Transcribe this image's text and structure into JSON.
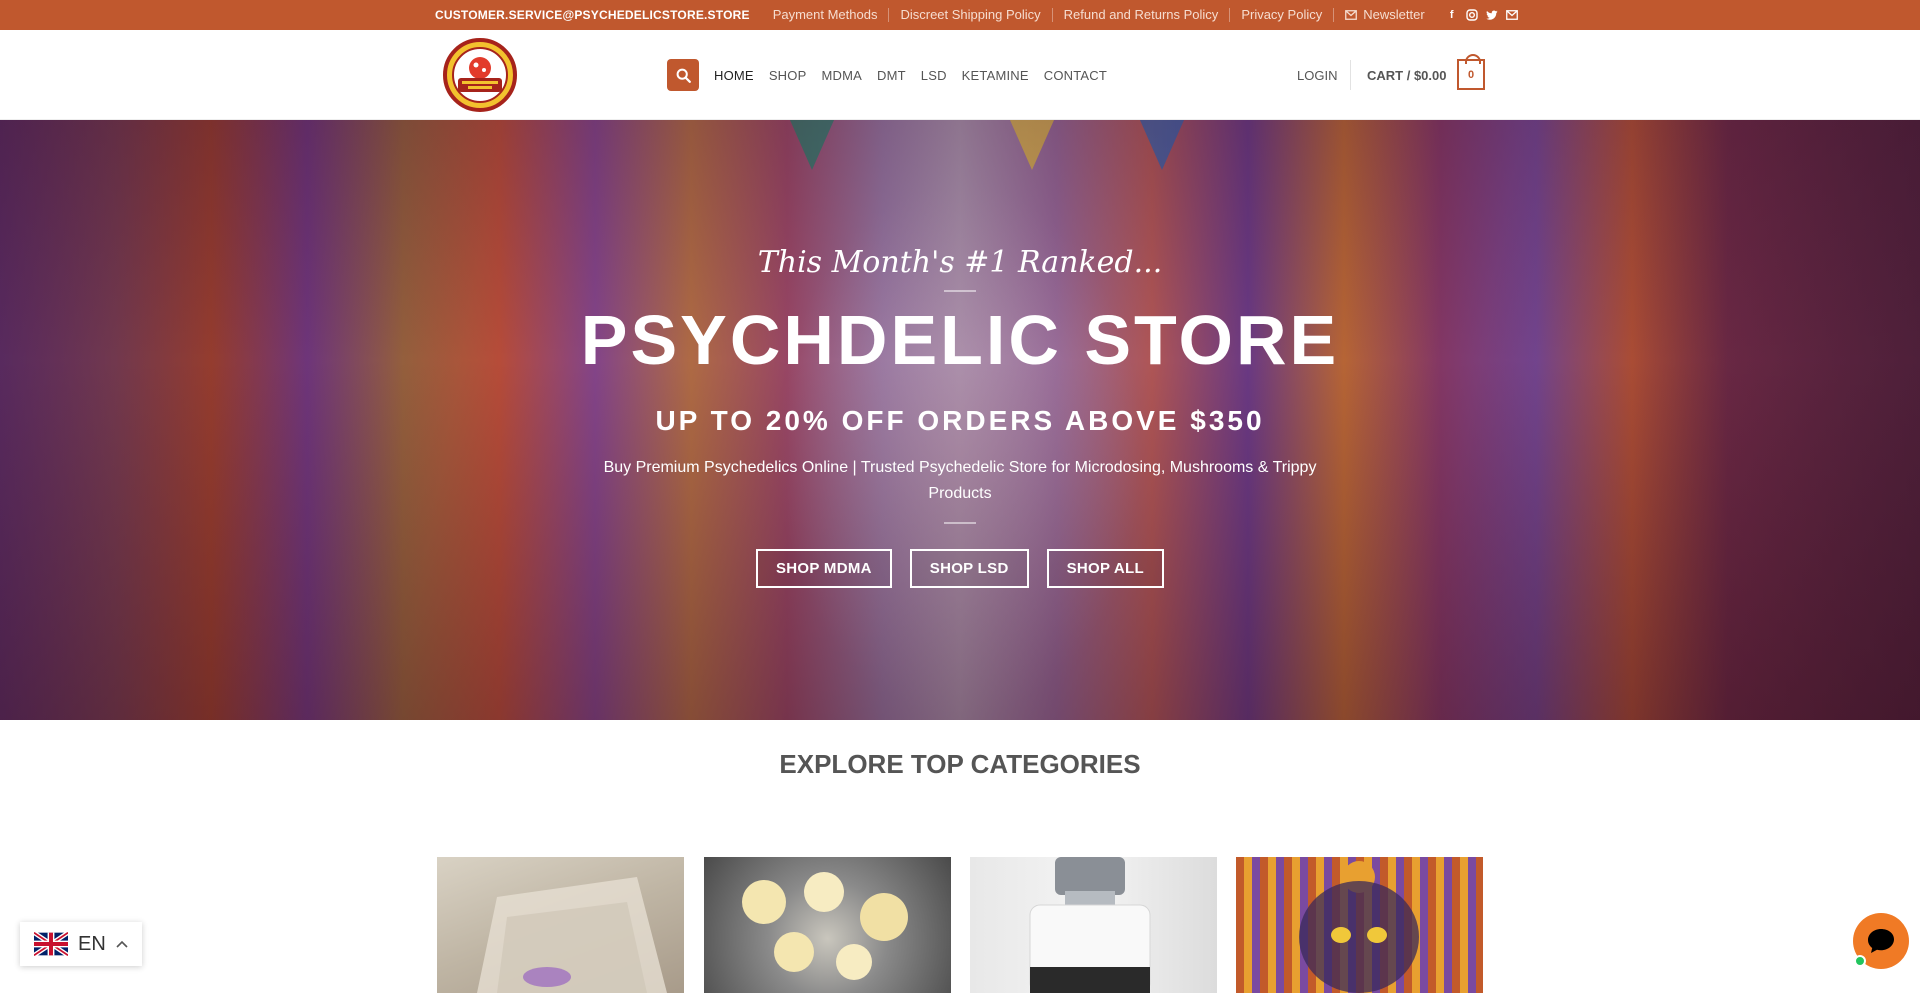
{
  "topbar": {
    "email": "CUSTOMER.SERVICE@PSYCHEDELICSTORE.STORE",
    "links": [
      "Payment Methods",
      "Discreet Shipping Policy",
      "Refund and Returns Policy",
      "Privacy Policy"
    ],
    "newsletter": "Newsletter",
    "social_icons": [
      "facebook-icon",
      "instagram-icon",
      "twitter-icon",
      "email-icon"
    ],
    "bg_color": "#c0582e"
  },
  "header": {
    "logo_icon": "store-logo",
    "nav": [
      "HOME",
      "SHOP",
      "MDMA",
      "DMT",
      "LSD",
      "KETAMINE",
      "CONTACT"
    ],
    "active_nav": "HOME",
    "login": "LOGIN",
    "cart_label": "CART / $0.00",
    "cart_count": "0",
    "accent": "#c0582e"
  },
  "hero": {
    "kicker": "This Month's #1 Ranked...",
    "title": "PSYCHDELIC STORE",
    "subtitle": "UP TO 20% OFF ORDERS ABOVE $350",
    "description": "Buy Premium Psychedelics Online | Trusted Psychedelic Store for Microdosing, Mushrooms & Trippy Products",
    "buttons": [
      "SHOP MDMA",
      "SHOP LSD",
      "SHOP ALL"
    ]
  },
  "categories": {
    "title": "EXPLORE TOP CATEGORIES"
  },
  "language": {
    "code": "EN",
    "flag_icon": "uk-flag-icon"
  },
  "chat": {
    "icon": "chat-icon",
    "status_color": "#22c55e"
  }
}
